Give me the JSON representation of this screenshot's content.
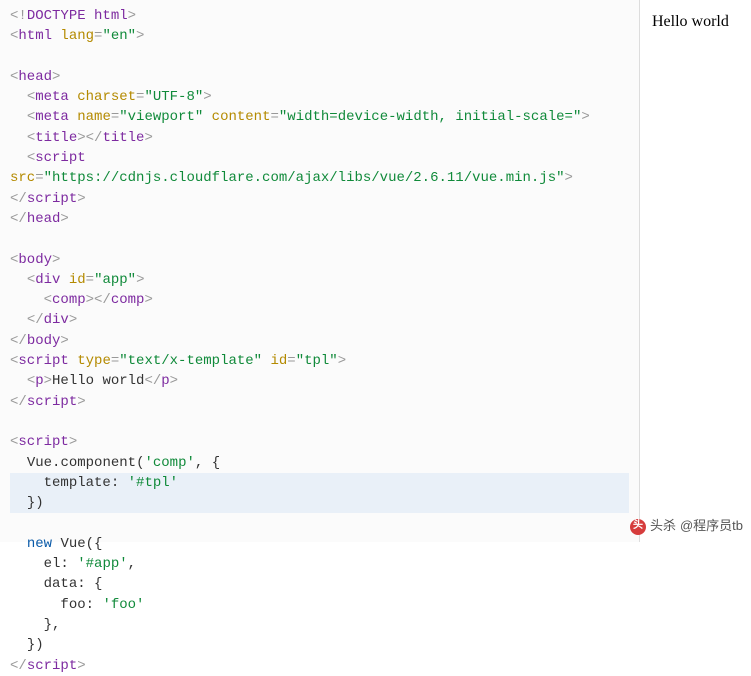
{
  "preview": {
    "text": "Hello world"
  },
  "code": {
    "l1_doctype": "DOCTYPE html",
    "l2_tag": "html",
    "l2_attr": "lang",
    "l2_val": "\"en\"",
    "l4_tag": "head",
    "l5_tag": "meta",
    "l5_attr": "charset",
    "l5_val": "\"UTF-8\"",
    "l6_tag": "meta",
    "l6_a1": "name",
    "l6_v1": "\"viewport\"",
    "l6_a2": "content",
    "l6_v2": "\"width=device-width, initial-scale=\"",
    "l7_tag": "title",
    "l8_tag": "script",
    "l9_attr": "src",
    "l9_val": "\"https://cdnjs.cloudflare.com/ajax/libs/vue/2.6.11/vue.min.js\"",
    "l10_tag": "script",
    "l11_tag": "head",
    "l13_tag": "body",
    "l14_tag": "div",
    "l14_attr": "id",
    "l14_val": "\"app\"",
    "l15_tag": "comp",
    "l16_tag": "div",
    "l17_tag": "body",
    "l18_tag": "script",
    "l18_a1": "type",
    "l18_v1": "\"text/x-template\"",
    "l18_a2": "id",
    "l18_v2": "\"tpl\"",
    "l19_tag": "p",
    "l19_text": "Hello world",
    "l20_tag": "script",
    "l22_tag": "script",
    "l23_obj": "Vue",
    "l23_fn": "component",
    "l23_arg": "'comp'",
    "l24_key": "template",
    "l24_val": "'#tpl'",
    "l25_close": "})",
    "l27_new": "new",
    "l27_cls": "Vue",
    "l28_key": "el",
    "l28_val": "'#app'",
    "l29_key": "data",
    "l30_key": "foo",
    "l30_val": "'foo'",
    "l33_tag": "script"
  },
  "watermark": {
    "prefix": "头杀",
    "handle": "@程序员tb"
  }
}
